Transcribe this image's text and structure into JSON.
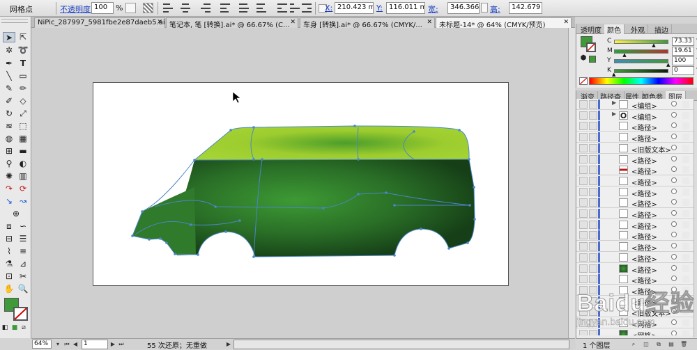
{
  "control_bar": {
    "mode_label": "网格点",
    "opacity_label": "不透明度:",
    "opacity_value": "100",
    "opacity_unit": "%",
    "x_label": "X:",
    "x_value": "210.423 mm",
    "y_label": "Y:",
    "y_value": "116.011 mm",
    "w_label": "宽:",
    "w_value": "346.366 m",
    "h_label": "高:",
    "h_value": "142.679 m"
  },
  "doc_tabs": [
    {
      "label": "NiPic_287997_5981fbe2e87daeb5.ai*",
      "close": "✕",
      "active": false
    },
    {
      "label": "笔记本, 笔 [转换].ai* @ 66.67% (C...",
      "close": "✕",
      "active": false
    },
    {
      "label": "车身 [转换].ai* @ 66.67% (CMYK/...",
      "close": "✕",
      "active": false
    },
    {
      "label": "未标题-14* @ 64% (CMYK/预览)",
      "close": "✕",
      "active": true
    }
  ],
  "color_panel": {
    "tabs": [
      "透明度",
      "颜色",
      "外观",
      "描边"
    ],
    "active_tab": "颜色",
    "fill_color": "#3f9a3a",
    "channels": [
      {
        "label": "C",
        "value": "73.33",
        "unit": "%",
        "level": 0.7333
      },
      {
        "label": "M",
        "value": "19.61",
        "unit": "%",
        "level": 0.1961
      },
      {
        "label": "Y",
        "value": "100",
        "unit": "%",
        "level": 1.0
      },
      {
        "label": "K",
        "value": "0",
        "unit": "%",
        "level": 0.0
      }
    ]
  },
  "layers_panel": {
    "tabs": [
      "渐变",
      "路径查",
      "属性",
      "颜色参",
      "图层"
    ],
    "active_tab": "图层",
    "rows": [
      {
        "name": "<编组>",
        "twirl": "▶",
        "thumb": "blank"
      },
      {
        "name": "<编组>",
        "twirl": "▶",
        "thumb": "ring"
      },
      {
        "name": "<路径>",
        "twirl": "",
        "thumb": "blank"
      },
      {
        "name": "<路径>",
        "twirl": "",
        "thumb": "blank"
      },
      {
        "name": "<旧版文本>",
        "twirl": "",
        "thumb": "blank"
      },
      {
        "name": "<路径>",
        "twirl": "",
        "thumb": "blank"
      },
      {
        "name": "<路径>",
        "twirl": "",
        "thumb": "red"
      },
      {
        "name": "<路径>",
        "twirl": "",
        "thumb": "blank"
      },
      {
        "name": "<路径>",
        "twirl": "",
        "thumb": "blank"
      },
      {
        "name": "<路径>",
        "twirl": "",
        "thumb": "blank"
      },
      {
        "name": "<路径>",
        "twirl": "",
        "thumb": "blank"
      },
      {
        "name": "<路径>",
        "twirl": "",
        "thumb": "blank"
      },
      {
        "name": "<路径>",
        "twirl": "",
        "thumb": "blank"
      },
      {
        "name": "<路径>",
        "twirl": "",
        "thumb": "blank"
      },
      {
        "name": "<路径>",
        "twirl": "",
        "thumb": "blank"
      },
      {
        "name": "<路径>",
        "twirl": "",
        "thumb": "green"
      },
      {
        "name": "<路径>",
        "twirl": "",
        "thumb": "blank"
      },
      {
        "name": "<路径>",
        "twirl": "",
        "thumb": "blank"
      },
      {
        "name": "<路径>",
        "twirl": "",
        "thumb": "blank"
      },
      {
        "name": "<旧版文本>",
        "twirl": "",
        "thumb": "blank"
      },
      {
        "name": "<网格>",
        "twirl": "",
        "thumb": "blank"
      },
      {
        "name": "<网格>",
        "twirl": "",
        "thumb": "green"
      },
      {
        "name": "<网格>",
        "twirl": "",
        "thumb": "green"
      }
    ],
    "footer": "1 个图层"
  },
  "status_bar": {
    "zoom": "64%",
    "page": "1",
    "info": "55 次还原；无重做"
  },
  "watermark": {
    "logo": "Baidu经验",
    "url": "jingyan.baidu.com"
  }
}
